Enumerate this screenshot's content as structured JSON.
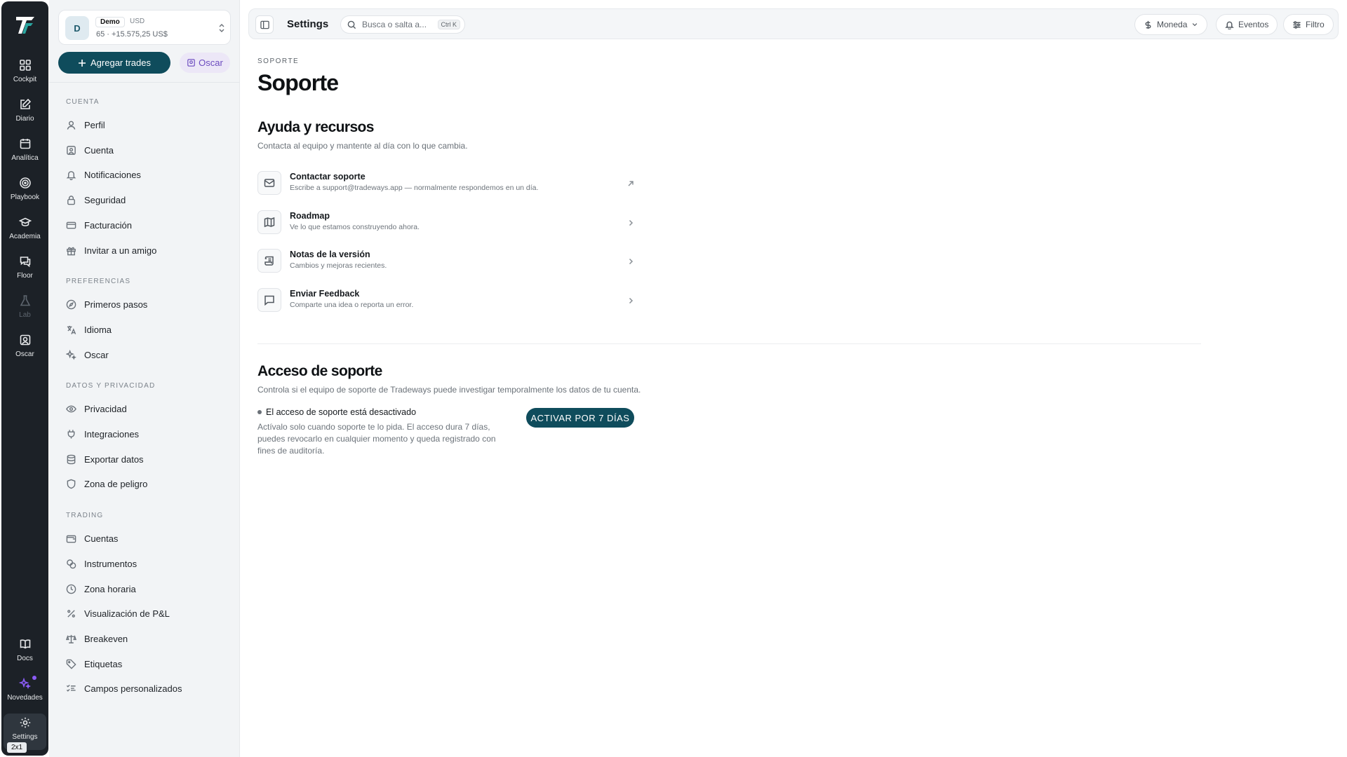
{
  "rail": {
    "items": [
      {
        "label": "Cockpit",
        "icon": "grid-icon"
      },
      {
        "label": "Diario",
        "icon": "edit-icon"
      },
      {
        "label": "Analítica",
        "icon": "calendar-icon"
      },
      {
        "label": "Playbook",
        "icon": "target-icon"
      },
      {
        "label": "Academia",
        "icon": "graduation-cap-icon"
      },
      {
        "label": "Floor",
        "icon": "chat-icon"
      },
      {
        "label": "Lab",
        "icon": "flask-icon"
      },
      {
        "label": "Oscar",
        "icon": "user-square-icon"
      },
      {
        "label": "Docs",
        "icon": "book-icon"
      },
      {
        "label": "Novedades",
        "icon": "sparkle-icon"
      },
      {
        "label": "Settings",
        "icon": "gear-icon"
      }
    ],
    "zoom_badge": "2x1"
  },
  "account": {
    "avatar": "D",
    "tag": "Demo",
    "currency": "USD",
    "summary": "65 · +15.575,25 US$"
  },
  "sidebar": {
    "add_trades": "Agregar trades",
    "oscar": "Oscar",
    "sections": [
      {
        "label": "CUENTA",
        "items": [
          "Perfil",
          "Cuenta",
          "Notificaciones",
          "Seguridad",
          "Facturación",
          "Invitar a un amigo"
        ]
      },
      {
        "label": "PREFERENCIAS",
        "items": [
          "Primeros pasos",
          "Idioma",
          "Oscar"
        ]
      },
      {
        "label": "DATOS Y PRIVACIDAD",
        "items": [
          "Privacidad",
          "Integraciones",
          "Exportar datos",
          "Zona de peligro"
        ]
      },
      {
        "label": "TRADING",
        "items": [
          "Cuentas",
          "Instrumentos",
          "Zona horaria",
          "Visualización de P&L",
          "Breakeven",
          "Etiquetas",
          "Campos personalizados"
        ]
      }
    ]
  },
  "topbar": {
    "title": "Settings",
    "search_placeholder": "Busca o salta a...",
    "shortcut": "Ctrl K",
    "currency_btn": "Moneda",
    "events_btn": "Eventos",
    "filter_btn": "Filtro"
  },
  "main": {
    "breadcrumb": "SOPORTE",
    "title": "Soporte",
    "help": {
      "title": "Ayuda y recursos",
      "subtitle": "Contacta al equipo y mantente al día con lo que cambia.",
      "items": [
        {
          "title": "Contactar soporte",
          "desc": "Escribe a support@tradeways.app — normalmente respondemos en un día."
        },
        {
          "title": "Roadmap",
          "desc": "Ve lo que estamos construyendo ahora."
        },
        {
          "title": "Notas de la versión",
          "desc": "Cambios y mejoras recientes."
        },
        {
          "title": "Enviar Feedback",
          "desc": "Comparte una idea o reporta un error."
        }
      ]
    },
    "access": {
      "title": "Acceso de soporte",
      "subtitle": "Controla si el equipo de soporte de Tradeways puede investigar temporalmente los datos de tu cuenta.",
      "status": "El acceso de soporte está desactivado",
      "desc": "Actívalo solo cuando soporte te lo pida. El acceso dura 7 días, puedes revocarlo en cualquier momento y queda registrado con fines de auditoría.",
      "button": "ACTIVAR POR 7 DÍAS"
    }
  }
}
